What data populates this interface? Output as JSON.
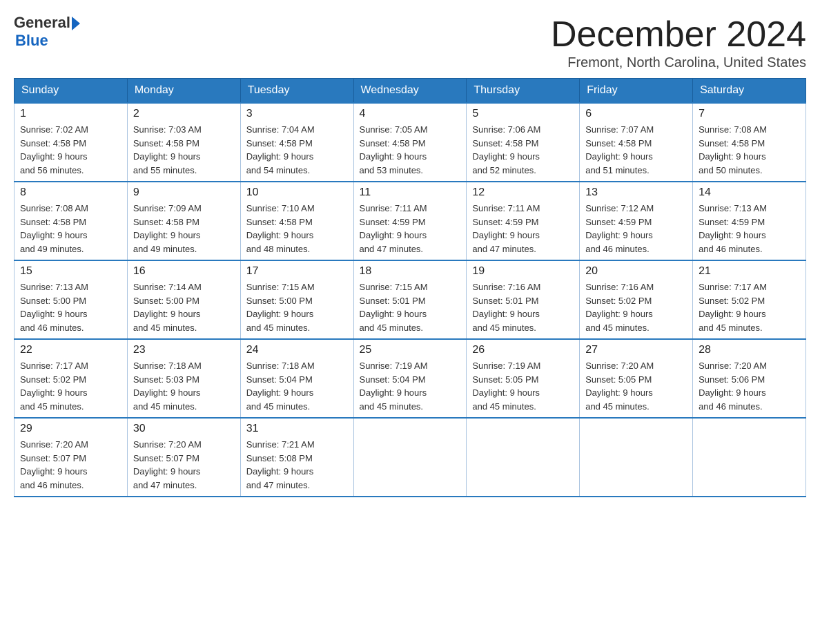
{
  "logo": {
    "general": "General",
    "arrow": "▶",
    "blue": "Blue"
  },
  "title": {
    "month": "December 2024",
    "location": "Fremont, North Carolina, United States"
  },
  "weekdays": [
    "Sunday",
    "Monday",
    "Tuesday",
    "Wednesday",
    "Thursday",
    "Friday",
    "Saturday"
  ],
  "weeks": [
    [
      {
        "day": "1",
        "sunrise": "Sunrise: 7:02 AM",
        "sunset": "Sunset: 4:58 PM",
        "daylight": "Daylight: 9 hours",
        "minutes": "and 56 minutes."
      },
      {
        "day": "2",
        "sunrise": "Sunrise: 7:03 AM",
        "sunset": "Sunset: 4:58 PM",
        "daylight": "Daylight: 9 hours",
        "minutes": "and 55 minutes."
      },
      {
        "day": "3",
        "sunrise": "Sunrise: 7:04 AM",
        "sunset": "Sunset: 4:58 PM",
        "daylight": "Daylight: 9 hours",
        "minutes": "and 54 minutes."
      },
      {
        "day": "4",
        "sunrise": "Sunrise: 7:05 AM",
        "sunset": "Sunset: 4:58 PM",
        "daylight": "Daylight: 9 hours",
        "minutes": "and 53 minutes."
      },
      {
        "day": "5",
        "sunrise": "Sunrise: 7:06 AM",
        "sunset": "Sunset: 4:58 PM",
        "daylight": "Daylight: 9 hours",
        "minutes": "and 52 minutes."
      },
      {
        "day": "6",
        "sunrise": "Sunrise: 7:07 AM",
        "sunset": "Sunset: 4:58 PM",
        "daylight": "Daylight: 9 hours",
        "minutes": "and 51 minutes."
      },
      {
        "day": "7",
        "sunrise": "Sunrise: 7:08 AM",
        "sunset": "Sunset: 4:58 PM",
        "daylight": "Daylight: 9 hours",
        "minutes": "and 50 minutes."
      }
    ],
    [
      {
        "day": "8",
        "sunrise": "Sunrise: 7:08 AM",
        "sunset": "Sunset: 4:58 PM",
        "daylight": "Daylight: 9 hours",
        "minutes": "and 49 minutes."
      },
      {
        "day": "9",
        "sunrise": "Sunrise: 7:09 AM",
        "sunset": "Sunset: 4:58 PM",
        "daylight": "Daylight: 9 hours",
        "minutes": "and 49 minutes."
      },
      {
        "day": "10",
        "sunrise": "Sunrise: 7:10 AM",
        "sunset": "Sunset: 4:58 PM",
        "daylight": "Daylight: 9 hours",
        "minutes": "and 48 minutes."
      },
      {
        "day": "11",
        "sunrise": "Sunrise: 7:11 AM",
        "sunset": "Sunset: 4:59 PM",
        "daylight": "Daylight: 9 hours",
        "minutes": "and 47 minutes."
      },
      {
        "day": "12",
        "sunrise": "Sunrise: 7:11 AM",
        "sunset": "Sunset: 4:59 PM",
        "daylight": "Daylight: 9 hours",
        "minutes": "and 47 minutes."
      },
      {
        "day": "13",
        "sunrise": "Sunrise: 7:12 AM",
        "sunset": "Sunset: 4:59 PM",
        "daylight": "Daylight: 9 hours",
        "minutes": "and 46 minutes."
      },
      {
        "day": "14",
        "sunrise": "Sunrise: 7:13 AM",
        "sunset": "Sunset: 4:59 PM",
        "daylight": "Daylight: 9 hours",
        "minutes": "and 46 minutes."
      }
    ],
    [
      {
        "day": "15",
        "sunrise": "Sunrise: 7:13 AM",
        "sunset": "Sunset: 5:00 PM",
        "daylight": "Daylight: 9 hours",
        "minutes": "and 46 minutes."
      },
      {
        "day": "16",
        "sunrise": "Sunrise: 7:14 AM",
        "sunset": "Sunset: 5:00 PM",
        "daylight": "Daylight: 9 hours",
        "minutes": "and 45 minutes."
      },
      {
        "day": "17",
        "sunrise": "Sunrise: 7:15 AM",
        "sunset": "Sunset: 5:00 PM",
        "daylight": "Daylight: 9 hours",
        "minutes": "and 45 minutes."
      },
      {
        "day": "18",
        "sunrise": "Sunrise: 7:15 AM",
        "sunset": "Sunset: 5:01 PM",
        "daylight": "Daylight: 9 hours",
        "minutes": "and 45 minutes."
      },
      {
        "day": "19",
        "sunrise": "Sunrise: 7:16 AM",
        "sunset": "Sunset: 5:01 PM",
        "daylight": "Daylight: 9 hours",
        "minutes": "and 45 minutes."
      },
      {
        "day": "20",
        "sunrise": "Sunrise: 7:16 AM",
        "sunset": "Sunset: 5:02 PM",
        "daylight": "Daylight: 9 hours",
        "minutes": "and 45 minutes."
      },
      {
        "day": "21",
        "sunrise": "Sunrise: 7:17 AM",
        "sunset": "Sunset: 5:02 PM",
        "daylight": "Daylight: 9 hours",
        "minutes": "and 45 minutes."
      }
    ],
    [
      {
        "day": "22",
        "sunrise": "Sunrise: 7:17 AM",
        "sunset": "Sunset: 5:02 PM",
        "daylight": "Daylight: 9 hours",
        "minutes": "and 45 minutes."
      },
      {
        "day": "23",
        "sunrise": "Sunrise: 7:18 AM",
        "sunset": "Sunset: 5:03 PM",
        "daylight": "Daylight: 9 hours",
        "minutes": "and 45 minutes."
      },
      {
        "day": "24",
        "sunrise": "Sunrise: 7:18 AM",
        "sunset": "Sunset: 5:04 PM",
        "daylight": "Daylight: 9 hours",
        "minutes": "and 45 minutes."
      },
      {
        "day": "25",
        "sunrise": "Sunrise: 7:19 AM",
        "sunset": "Sunset: 5:04 PM",
        "daylight": "Daylight: 9 hours",
        "minutes": "and 45 minutes."
      },
      {
        "day": "26",
        "sunrise": "Sunrise: 7:19 AM",
        "sunset": "Sunset: 5:05 PM",
        "daylight": "Daylight: 9 hours",
        "minutes": "and 45 minutes."
      },
      {
        "day": "27",
        "sunrise": "Sunrise: 7:20 AM",
        "sunset": "Sunset: 5:05 PM",
        "daylight": "Daylight: 9 hours",
        "minutes": "and 45 minutes."
      },
      {
        "day": "28",
        "sunrise": "Sunrise: 7:20 AM",
        "sunset": "Sunset: 5:06 PM",
        "daylight": "Daylight: 9 hours",
        "minutes": "and 46 minutes."
      }
    ],
    [
      {
        "day": "29",
        "sunrise": "Sunrise: 7:20 AM",
        "sunset": "Sunset: 5:07 PM",
        "daylight": "Daylight: 9 hours",
        "minutes": "and 46 minutes."
      },
      {
        "day": "30",
        "sunrise": "Sunrise: 7:20 AM",
        "sunset": "Sunset: 5:07 PM",
        "daylight": "Daylight: 9 hours",
        "minutes": "and 47 minutes."
      },
      {
        "day": "31",
        "sunrise": "Sunrise: 7:21 AM",
        "sunset": "Sunset: 5:08 PM",
        "daylight": "Daylight: 9 hours",
        "minutes": "and 47 minutes."
      },
      null,
      null,
      null,
      null
    ]
  ]
}
